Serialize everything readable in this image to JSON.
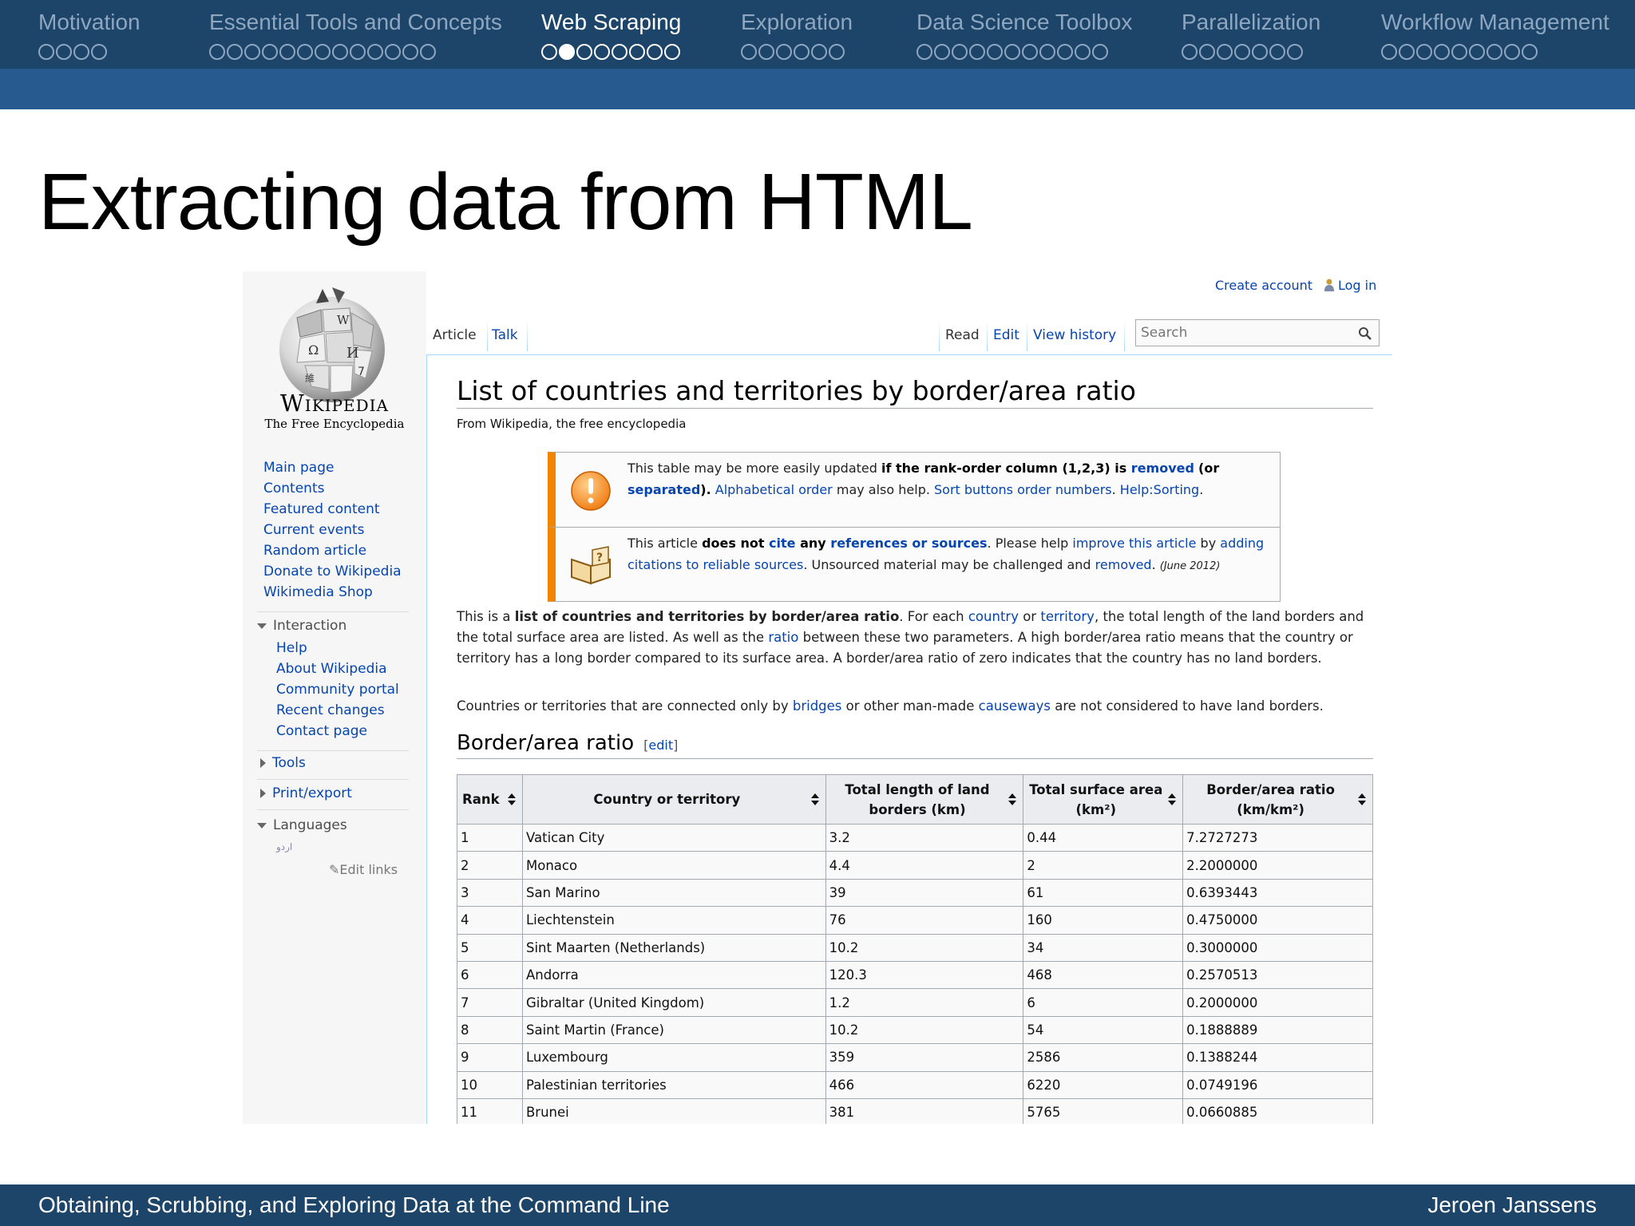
{
  "nav": {
    "sections": [
      {
        "name": "Motivation",
        "dots": 4,
        "active_dot": -1
      },
      {
        "name": "Essential Tools and Concepts",
        "dots": 13,
        "active_dot": -1
      },
      {
        "name": "Web Scraping",
        "dots": 8,
        "active_dot": 1
      },
      {
        "name": "Exploration",
        "dots": 6,
        "active_dot": -1
      },
      {
        "name": "Data Science Toolbox",
        "dots": 11,
        "active_dot": -1
      },
      {
        "name": "Parallelization",
        "dots": 7,
        "active_dot": -1
      },
      {
        "name": "Workflow Management",
        "dots": 9,
        "active_dot": -1
      }
    ]
  },
  "slide": {
    "title": "Extracting data from HTML"
  },
  "footer": {
    "left": "Obtaining, Scrubbing, and Exploring Data at the Command Line",
    "right": "Jeroen Janssens"
  },
  "wiki": {
    "wordmark": "Wikipedia",
    "tagline": "The Free Encyclopedia",
    "personal": {
      "create": "Create account",
      "login": "Log in"
    },
    "tabs": {
      "article": "Article",
      "talk": "Talk",
      "read": "Read",
      "edit": "Edit",
      "history": "View history"
    },
    "search_placeholder": "Search",
    "nav_links": [
      "Main page",
      "Contents",
      "Featured content",
      "Current events",
      "Random article",
      "Donate to Wikipedia",
      "Wikimedia Shop"
    ],
    "interaction": {
      "heading": "Interaction",
      "links": [
        "Help",
        "About Wikipedia",
        "Community portal",
        "Recent changes",
        "Contact page"
      ]
    },
    "tools": "Tools",
    "print_export": "Print/export",
    "languages": {
      "heading": "Languages",
      "item": "اردو",
      "edit_links": "Edit links"
    },
    "page_title": "List of countries and territories by border/area ratio",
    "from": "From Wikipedia, the free encyclopedia",
    "ambox1": {
      "t1": "This table may be more easily updated ",
      "b1": "if the rank-order column (1,2,3) is ",
      "l1": "removed",
      "b2": "(or ",
      "l2": "separated",
      "b3": ").",
      "l3": "Alphabetical order",
      "t2": " may also help. ",
      "l4": "Sort buttons order numbers",
      "t3": ". ",
      "l5": "Help:Sorting",
      "t4": "."
    },
    "ambox2": {
      "t1": "This article ",
      "b1": "does not ",
      "l1": "cite",
      "b2": " any ",
      "l2": "references or sources",
      "t2": ". Please help ",
      "l3": "improve this article",
      "t3": " by ",
      "l4": "adding citations to reliable sources",
      "t4": ". Unsourced material may be challenged and ",
      "l5": "removed",
      "t5": ". ",
      "date": "(June 2012)"
    },
    "intro": {
      "t1": "This is a ",
      "b1": "list of countries and territories by border/area ratio",
      "t2": ". For each ",
      "l1": "country",
      "t3": " or ",
      "l2": "territory",
      "t4": ", the total length of the land borders and the total surface area are listed. As well as the ",
      "l3": "ratio",
      "t5": " between these two parameters. A high border/area ratio means that the country or territory has a long border compared to its surface area. A border/area ratio of zero indicates that the country has no land borders."
    },
    "intro2": {
      "t1": "Countries or territories that are connected only by ",
      "l1": "bridges",
      "t2": " or other man-made ",
      "l2": "causeways",
      "t3": " are not considered to have land borders."
    },
    "section_heading": "Border/area ratio",
    "section_edit": "edit",
    "table": {
      "headers": [
        "Rank",
        "Country or territory",
        "Total length of land borders (km)",
        "Total surface area (km²)",
        "Border/area ratio (km/km²)"
      ],
      "rows": [
        [
          "1",
          "Vatican City",
          "3.2",
          "0.44",
          "7.2727273"
        ],
        [
          "2",
          "Monaco",
          "4.4",
          "2",
          "2.2000000"
        ],
        [
          "3",
          "San Marino",
          "39",
          "61",
          "0.6393443"
        ],
        [
          "4",
          "Liechtenstein",
          "76",
          "160",
          "0.4750000"
        ],
        [
          "5",
          "Sint Maarten (Netherlands)",
          "10.2",
          "34",
          "0.3000000"
        ],
        [
          "6",
          "Andorra",
          "120.3",
          "468",
          "0.2570513"
        ],
        [
          "7",
          "Gibraltar (United Kingdom)",
          "1.2",
          "6",
          "0.2000000"
        ],
        [
          "8",
          "Saint Martin (France)",
          "10.2",
          "54",
          "0.1888889"
        ],
        [
          "9",
          "Luxembourg",
          "359",
          "2586",
          "0.1388244"
        ],
        [
          "10",
          "Palestinian territories",
          "466",
          "6220",
          "0.0749196"
        ],
        [
          "11",
          "Brunei",
          "381",
          "5765",
          "0.0660885"
        ]
      ]
    }
  }
}
